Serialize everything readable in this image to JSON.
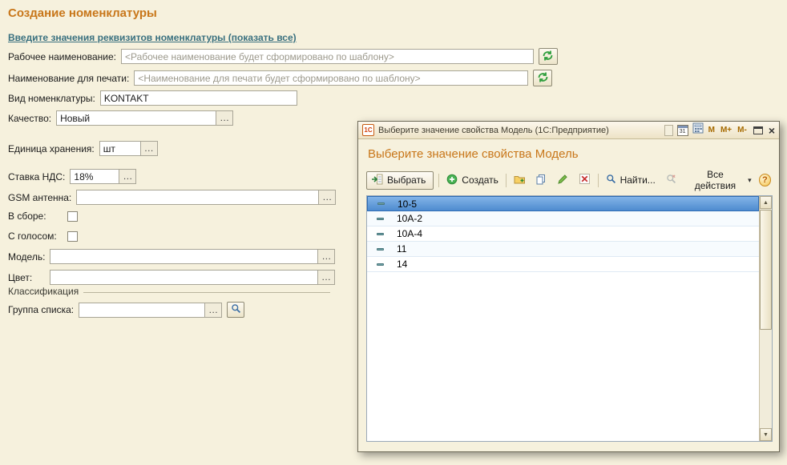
{
  "page": {
    "title": "Создание номенклатуры",
    "link": "Введите значения реквизитов номенклатуры (показать все)"
  },
  "form": {
    "working_name_label": "Рабочее наименование:",
    "working_name_placeholder": "<Рабочее наименование будет сформировано по шаблону>",
    "print_name_label": "Наименование для печати:",
    "print_name_placeholder": "<Наименование для печати будет сформировано по шаблону>",
    "kind_label": "Вид номенклатуры:",
    "kind_value": "KONTAKT",
    "quality_label": "Качество:",
    "quality_value": "Новый",
    "unit_label": "Единица хранения:",
    "unit_value": "шт",
    "vat_label": "Ставка НДС:",
    "vat_value": "18%",
    "gsm_label": "GSM антенна:",
    "gsm_value": "",
    "assembled_label": "В сборе:",
    "voice_label": "С голосом:",
    "model_label": "Модель:",
    "model_value": "",
    "color_label": "Цвет:",
    "color_value": "",
    "classification_label": "Классификация",
    "list_group_label": "Группа списка:",
    "list_group_value": "",
    "ellipsis": "…"
  },
  "dialog": {
    "titlebar": {
      "logo": "1С",
      "title": "Выберите значение свойства Модель  (1С:Предприятие)",
      "calendar_day": "31",
      "m": "M",
      "m_plus": "M+",
      "m_minus": "M-",
      "close": "×"
    },
    "heading": "Выберите значение свойства Модель",
    "toolbar": {
      "select": "Выбрать",
      "create": "Создать",
      "find": "Найти...",
      "all_actions": "Все действия",
      "all_actions_arrow": "▾",
      "help": "?"
    },
    "list": {
      "items": [
        "10-5",
        "10A-2",
        "10A-4",
        "11",
        "14"
      ],
      "selected_index": 0
    }
  },
  "icons": {
    "scroll_up": "▲",
    "scroll_down": "▼"
  }
}
